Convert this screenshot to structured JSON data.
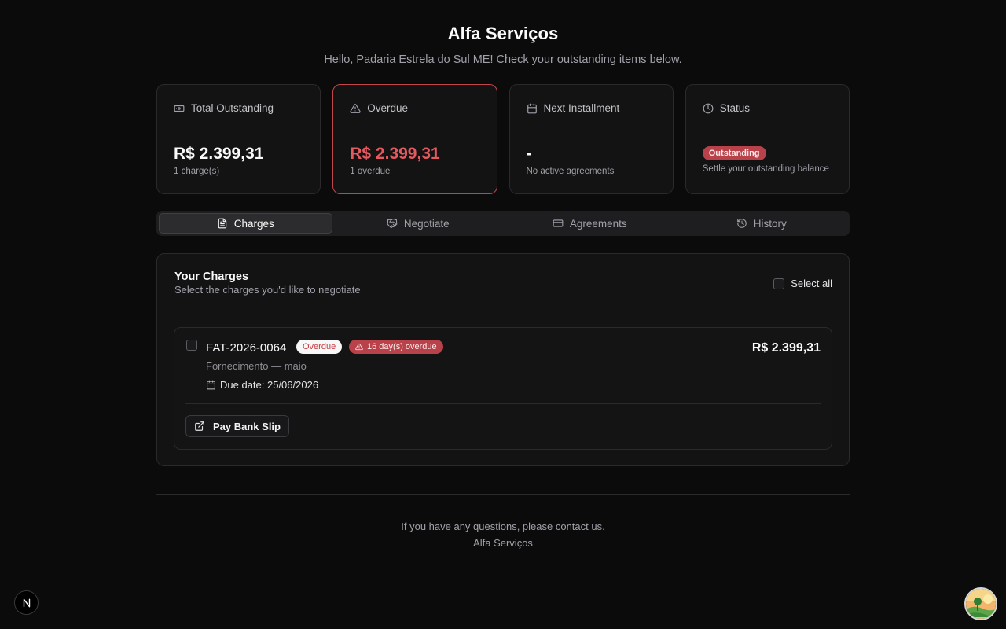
{
  "header": {
    "brand": "Alfa Serviços",
    "greeting": "Hello, Padaria Estrela do Sul ME! Check your outstanding items below."
  },
  "summary": {
    "total": {
      "label": "Total Outstanding",
      "icon": "banknote-icon",
      "value": "R$ 2.399,31",
      "sub": "1 charge(s)"
    },
    "overdue": {
      "label": "Overdue",
      "icon": "alert-triangle-icon",
      "value": "R$ 2.399,31",
      "sub": "1 overdue",
      "color": "#e5595f"
    },
    "next": {
      "label": "Next Installment",
      "icon": "calendar-icon",
      "value": "-",
      "sub": "No active agreements"
    },
    "status": {
      "label": "Status",
      "icon": "clock-icon",
      "badge": "Outstanding",
      "sub": "Settle your outstanding balance"
    }
  },
  "tabs": [
    {
      "label": "Charges",
      "icon": "file-text-icon",
      "active": true
    },
    {
      "label": "Negotiate",
      "icon": "handshake-icon",
      "active": false
    },
    {
      "label": "Agreements",
      "icon": "credit-card-icon",
      "active": false
    },
    {
      "label": "History",
      "icon": "history-icon",
      "active": false
    }
  ],
  "charges_panel": {
    "title": "Your Charges",
    "description": "Select the charges you'd like to negotiate",
    "select_all": "Select all",
    "items": [
      {
        "id": "FAT-2026-0064",
        "status_badge": "Overdue",
        "days_badge": "16 day(s) overdue",
        "description": "Fornecimento — maio",
        "due": "Due date: 25/06/2026",
        "amount": "R$ 2.399,31",
        "action": "Pay Bank Slip"
      }
    ]
  },
  "footer": {
    "contact": "If you have any questions, please contact us.",
    "company": "Alfa Serviços"
  },
  "colors": {
    "danger": "#b9424a",
    "danger_text": "#e5595f",
    "background": "#0b0b0c"
  }
}
